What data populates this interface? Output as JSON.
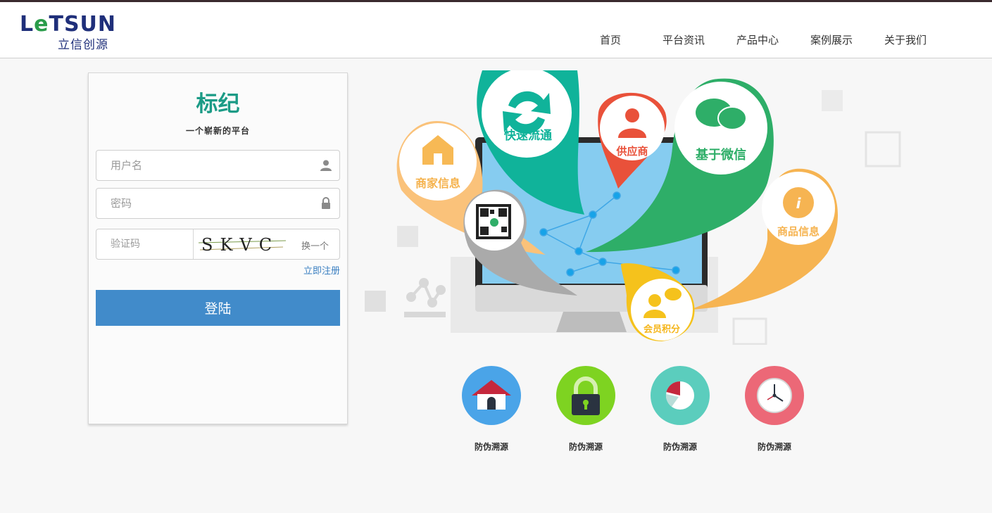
{
  "header": {
    "logo_text": "LETSUN",
    "logo_cn": "立信创源",
    "nav": [
      {
        "label": "首页"
      },
      {
        "label": "平台资讯"
      },
      {
        "label": "产品中心"
      },
      {
        "label": "案例展示"
      },
      {
        "label": "关于我们"
      }
    ]
  },
  "login": {
    "title": "标纪",
    "subtitle": "一个崭新的平台",
    "username_placeholder": "用户名",
    "password_placeholder": "密码",
    "captcha_placeholder": "验证码",
    "captcha_text": "SKVC",
    "captcha_refresh": "换一个",
    "register_link": "立即注册",
    "login_button": "登陆"
  },
  "hero": {
    "bubbles": {
      "fast": "快速流通",
      "supplier": "供应商",
      "wechat": "基于微信",
      "merchant": "商家信息",
      "product": "商品信息",
      "member": "会员积分"
    }
  },
  "features": [
    {
      "label": "防伪溯源",
      "icon": "house-icon",
      "color": "#4aa4e8"
    },
    {
      "label": "防伪溯源",
      "icon": "lock-icon",
      "color": "#7ed321"
    },
    {
      "label": "防伪溯源",
      "icon": "pie-chart-icon",
      "color": "#5bcdbd"
    },
    {
      "label": "防伪溯源",
      "icon": "clock-icon",
      "color": "#ec6877"
    }
  ]
}
